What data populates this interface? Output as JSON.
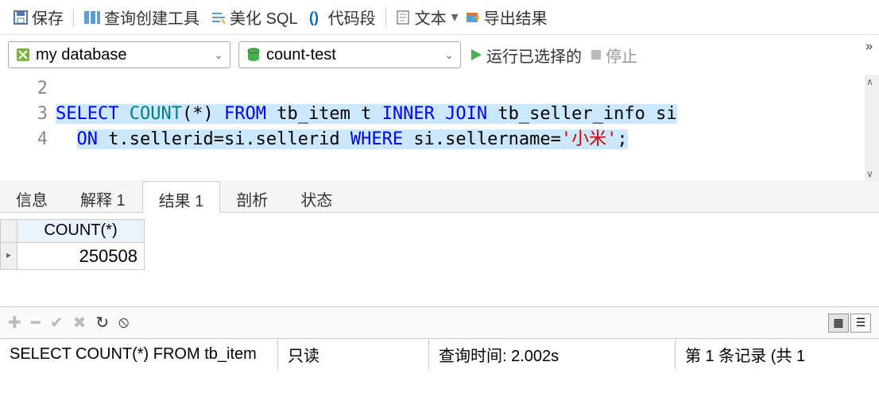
{
  "toolbar": {
    "save": "保存",
    "query_builder": "查询创建工具",
    "beautify_sql": "美化 SQL",
    "code_snippet": "代码段",
    "text": "文本",
    "export_results": "导出结果"
  },
  "selectors": {
    "connection": "my database",
    "database": "count-test",
    "run": "运行已选择的",
    "stop": "停止"
  },
  "editor": {
    "lines": [
      "2",
      "3",
      "",
      "4"
    ],
    "sql_tokens": {
      "select": "SELECT",
      "count": "COUNT",
      "star": "(*)",
      "from": "FROM",
      "t1": "tb_item t",
      "inner": "INNER",
      "join": "JOIN",
      "t2": "tb_seller_info si",
      "on": "ON",
      "cond": "t.sellerid=si.sellerid",
      "where": "WHERE",
      "cond2": "si.sellername=",
      "str": "'小米'",
      "semi": ";"
    }
  },
  "tabs": {
    "info": "信息",
    "explain": "解释 1",
    "result": "结果 1",
    "profile": "剖析",
    "status": "状态"
  },
  "grid": {
    "col_header": "COUNT(*)",
    "value": "250508",
    "row_marker": "▸"
  },
  "status": {
    "sql": "SELECT COUNT(*) FROM tb_item",
    "ro": "只读",
    "time": "查询时间: 2.002s",
    "record": "第 1 条记录  (共 1"
  }
}
